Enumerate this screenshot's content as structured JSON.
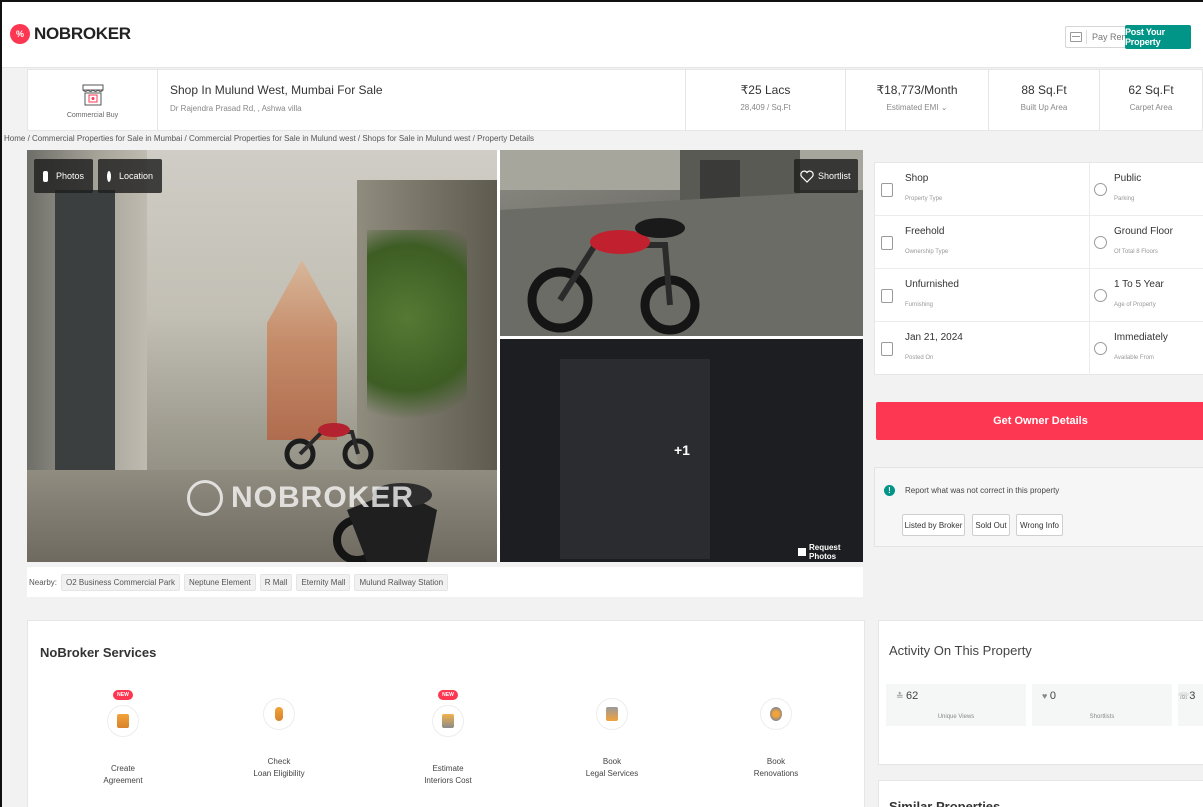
{
  "nav": {
    "logo_text": "NOBROKER",
    "pay_rent": "Pay Rent",
    "post_property": "Post Your Property"
  },
  "property": {
    "type_label": "Commercial Buy",
    "title": "Shop In Mulund West, Mumbai For Sale",
    "address": "Dr Rajendra Prasad Rd, , Ashwa villa",
    "price": "₹25 Lacs",
    "price_per_sqft": "28,409 / Sq.Ft",
    "emi": "₹18,773/Month",
    "emi_label": "Estimated EMI ⌄",
    "built_up": "88 Sq.Ft",
    "built_up_label": "Built Up Area",
    "carpet": "62 Sq.Ft",
    "carpet_label": "Carpet Area"
  },
  "breadcrumb": "Home / Commercial Properties for Sale in Mumbai / Commercial Properties for Sale in Mulund west / Shops for Sale in Mulund west / Property Details",
  "gallery": {
    "photos_label": "Photos",
    "location_label": "Location",
    "shortlist_label": "Shortlist",
    "more_count": "+1",
    "request_photos": "Request Photos",
    "watermark": "NOBROKER"
  },
  "nearby": {
    "label": "Nearby:",
    "places": [
      "O2 Business Commercial Park",
      "Neptune Element",
      "R Mall",
      "Eternity Mall",
      "Mulund Railway Station"
    ]
  },
  "details": [
    {
      "value": "Shop",
      "key": "Property Type",
      "icon": "shop-icon"
    },
    {
      "value": "Public",
      "key": "Parking",
      "icon": "parking-icon"
    },
    {
      "value": "Freehold",
      "key": "Ownership Type",
      "icon": "ownership-icon"
    },
    {
      "value": "Ground Floor",
      "key": "Of Total 8 Floors",
      "icon": "floor-icon"
    },
    {
      "value": "Unfurnished",
      "key": "Furnishing",
      "icon": "furnishing-icon"
    },
    {
      "value": "1 To 5 Year",
      "key": "Age of Property",
      "icon": "age-icon"
    },
    {
      "value": "Jan 21, 2024",
      "key": "Posted On",
      "icon": "posted-icon"
    },
    {
      "value": "Immediately",
      "key": "Available From",
      "icon": "calendar-icon"
    }
  ],
  "owner_button": "Get Owner Details",
  "report": {
    "text": "Report what was not correct in this property",
    "options": [
      "Listed by Broker",
      "Sold Out",
      "Wrong Info"
    ]
  },
  "services": {
    "title": "NoBroker Services",
    "items": [
      {
        "line1": "Create",
        "line2": "Agreement",
        "new": "NEW",
        "icon": "agreement-icon"
      },
      {
        "line1": "Check",
        "line2": "Loan Eligibility",
        "new": "",
        "icon": "loan-icon"
      },
      {
        "line1": "Estimate",
        "line2": "Interiors Cost",
        "new": "NEW",
        "icon": "interiors-icon"
      },
      {
        "line1": "Book",
        "line2": "Legal Services",
        "new": "",
        "icon": "legal-icon"
      },
      {
        "line1": "Book",
        "line2": "Renovations",
        "new": "",
        "icon": "renovation-icon"
      }
    ]
  },
  "activity": {
    "title": "Activity On This Property",
    "cards": [
      {
        "value": "62",
        "label": "Unique Views",
        "icon": "views-icon"
      },
      {
        "value": "0",
        "label": "Shortlists",
        "icon": "heart-icon"
      },
      {
        "value": "3",
        "label": "",
        "icon": "contact-icon"
      }
    ]
  },
  "similar_title": "Similar Properties",
  "colors": {
    "brand_red": "#fd3752",
    "brand_teal": "#009587"
  }
}
